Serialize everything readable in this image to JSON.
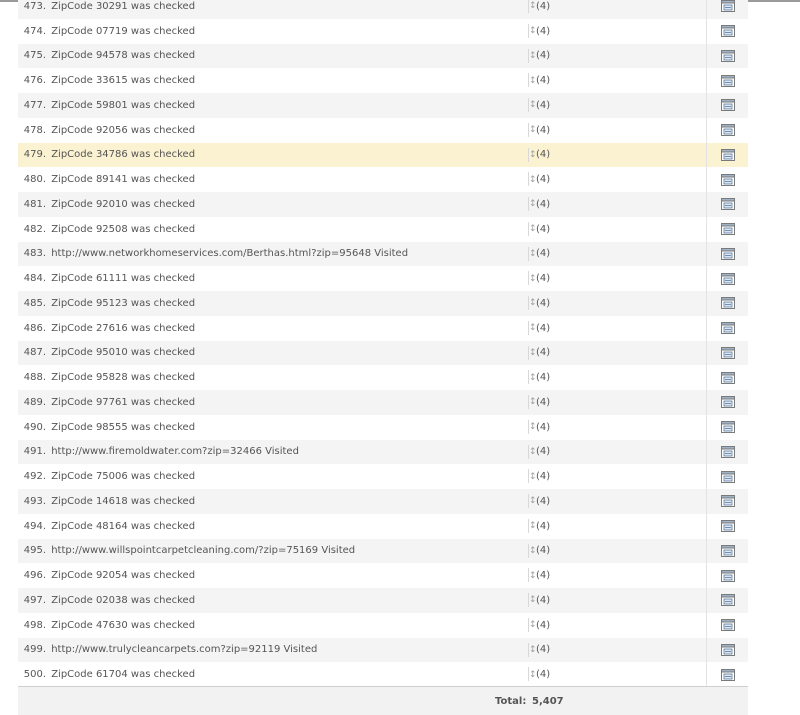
{
  "rows": [
    {
      "num": "473.",
      "text": "ZipCode 30291 was checked",
      "count": "(4)"
    },
    {
      "num": "474.",
      "text": "ZipCode 07719 was checked",
      "count": "(4)"
    },
    {
      "num": "475.",
      "text": "ZipCode 94578 was checked",
      "count": "(4)"
    },
    {
      "num": "476.",
      "text": "ZipCode 33615 was checked",
      "count": "(4)"
    },
    {
      "num": "477.",
      "text": "ZipCode 59801 was checked",
      "count": "(4)"
    },
    {
      "num": "478.",
      "text": "ZipCode 92056 was checked",
      "count": "(4)"
    },
    {
      "num": "479.",
      "text": "ZipCode 34786 was checked",
      "count": "(4)"
    },
    {
      "num": "480.",
      "text": "ZipCode 89141 was checked",
      "count": "(4)"
    },
    {
      "num": "481.",
      "text": "ZipCode 92010 was checked",
      "count": "(4)"
    },
    {
      "num": "482.",
      "text": "ZipCode 92508 was checked",
      "count": "(4)"
    },
    {
      "num": "483.",
      "text": "http://www.networkhomeservices.com/Berthas.html?zip=95648 Visited",
      "count": "(4)"
    },
    {
      "num": "484.",
      "text": "ZipCode 61111 was checked",
      "count": "(4)"
    },
    {
      "num": "485.",
      "text": "ZipCode 95123 was checked",
      "count": "(4)"
    },
    {
      "num": "486.",
      "text": "ZipCode 27616 was checked",
      "count": "(4)"
    },
    {
      "num": "487.",
      "text": "ZipCode 95010 was checked",
      "count": "(4)"
    },
    {
      "num": "488.",
      "text": "ZipCode 95828 was checked",
      "count": "(4)"
    },
    {
      "num": "489.",
      "text": "ZipCode 97761 was checked",
      "count": "(4)"
    },
    {
      "num": "490.",
      "text": "ZipCode 98555 was checked",
      "count": "(4)"
    },
    {
      "num": "491.",
      "text": "http://www.firemoldwater.com?zip=32466 Visited",
      "count": "(4)"
    },
    {
      "num": "492.",
      "text": "ZipCode 75006 was checked",
      "count": "(4)"
    },
    {
      "num": "493.",
      "text": "ZipCode 14618 was checked",
      "count": "(4)"
    },
    {
      "num": "494.",
      "text": "ZipCode 48164 was checked",
      "count": "(4)"
    },
    {
      "num": "495.",
      "text": "http://www.willspointcarpetcleaning.com/?zip=75169 Visited",
      "count": "(4)"
    },
    {
      "num": "496.",
      "text": "ZipCode 92054 was checked",
      "count": "(4)"
    },
    {
      "num": "497.",
      "text": "ZipCode 02038 was checked",
      "count": "(4)"
    },
    {
      "num": "498.",
      "text": "ZipCode 47630 was checked",
      "count": "(4)"
    },
    {
      "num": "499.",
      "text": "http://www.trulycleancarpets.com?zip=92119 Visited",
      "count": "(4)"
    },
    {
      "num": "500.",
      "text": "ZipCode 61704 was checked",
      "count": "(4)"
    }
  ],
  "highlighted_row": "479.",
  "icons": {
    "sort": "sort-arrows-icon",
    "action": "row-evolution-icon"
  },
  "colors": {
    "row_odd": "#f4f4f4",
    "row_even": "#ffffff",
    "row_highlight": "#fbf2d1",
    "text": "#555555"
  },
  "footer": {
    "total_label": "Total:",
    "total_value": "5,407"
  }
}
